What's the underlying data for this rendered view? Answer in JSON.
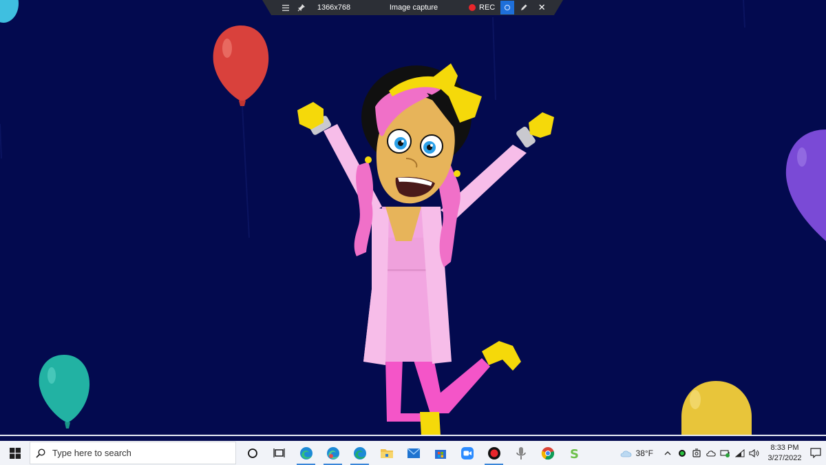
{
  "capture_toolbar": {
    "resolution": "1366x768",
    "title": "Image capture",
    "rec_label": "REC"
  },
  "taskbar": {
    "search_placeholder": "Type here to search",
    "weather_temp": "38°F",
    "clock_time": "8:33 PM",
    "clock_date": "3/27/2022"
  },
  "icons": {
    "taskbar": [
      "windows-start-icon",
      "search-icon",
      "cortana-icon",
      "task-view-icon",
      "edge-icon",
      "edge-beta-icon",
      "edge-dev-icon",
      "file-explorer-icon",
      "mail-icon",
      "store-icon",
      "zoom-icon",
      "record-icon",
      "microphone-icon",
      "chrome-icon",
      "green-s-app-icon"
    ],
    "tray": [
      "weather-icon",
      "chevron-up-icon",
      "green-dot-icon",
      "camera-icon",
      "onedrive-icon",
      "battery-icon",
      "wifi-icon",
      "speaker-icon",
      "notification-icon"
    ]
  },
  "colors": {
    "background": "#030a4f",
    "balloon_red": "#d9413c",
    "balloon_teal": "#22b2a3",
    "balloon_purple": "#7a4ad6",
    "balloon_yellow": "#e8c53a",
    "rec_red": "#e8262b"
  }
}
